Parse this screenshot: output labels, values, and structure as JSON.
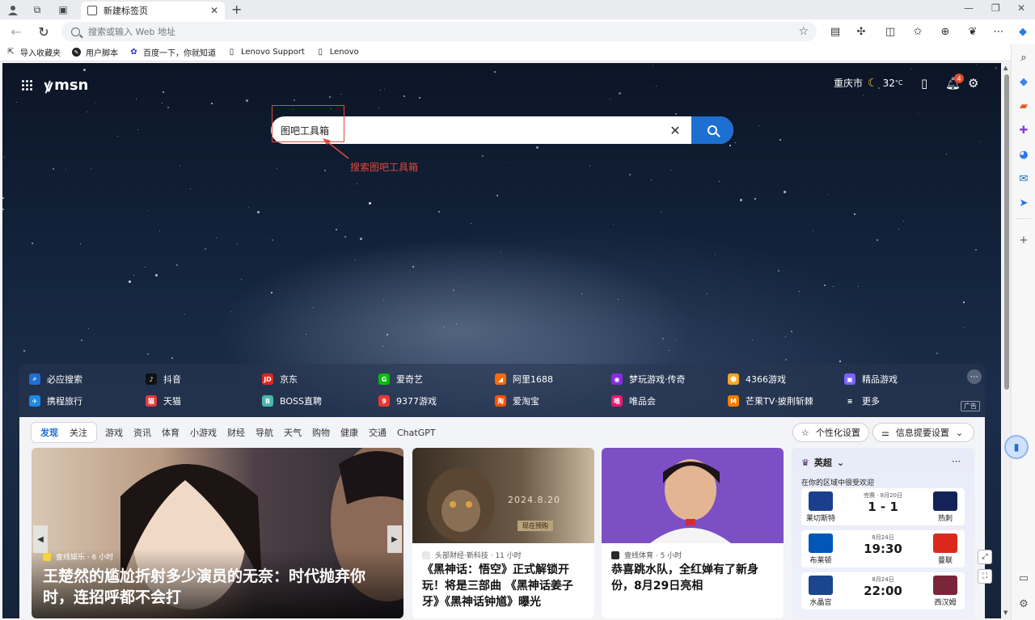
{
  "browser": {
    "tab_title": "新建标签页",
    "address_placeholder": "搜索或输入 Web 地址",
    "bookmarks": [
      "导入收藏夹",
      "用户脚本",
      "百度一下，你就知道",
      "Lenovo Support",
      "Lenovo"
    ]
  },
  "msn": {
    "logo": "msn",
    "city": "重庆市",
    "temperature": "32",
    "temp_unit": "°C",
    "notification_count": "4"
  },
  "search": {
    "query": "图吧工具箱",
    "annotation": "搜索图吧工具箱"
  },
  "quick_links": {
    "row1": [
      "必应搜索",
      "抖音",
      "京东",
      "爱奇艺",
      "阿里1688",
      "梦玩游戏·传奇",
      "4366游戏",
      "精品游戏"
    ],
    "row2": [
      "携程旅行",
      "天猫",
      "BOSS直聘",
      "9377游戏",
      "爱淘宝",
      "唯品会",
      "芒果TV·披荆斩棘",
      "更多"
    ],
    "ad_label": "广告",
    "colors": [
      "#1d6fd1",
      "#111111",
      "#e1251b",
      "#00be06",
      "#ff6a00",
      "#8a2be2",
      "#f5a623",
      "#7b61ff",
      "#1e88e5",
      "#e4393c",
      "#4db6ac",
      "#e53935",
      "#ff5000",
      "#e8196f",
      "#f57c00",
      "#ffffff"
    ]
  },
  "feed": {
    "tabs": [
      "发现",
      "关注"
    ],
    "categories": [
      "游戏",
      "资讯",
      "体育",
      "小游戏",
      "财经",
      "导航",
      "天气",
      "购物",
      "健康",
      "交通",
      "ChatGPT"
    ],
    "personalize": "个性化设置",
    "feed_settings": "信息提要设置"
  },
  "cards": [
    {
      "source": "壹线娱乐 · 6 小时",
      "headline": "王楚然的尴尬折射多少演员的无奈：时代抛弃你时，连招呼都不会打"
    },
    {
      "source": "头部财经·新科技 · 11 小时",
      "headline": "《黑神话：悟空》正式解锁开玩！将是三部曲 《黑神话姜子牙》《黑神话钟馗》曝光",
      "poster_text": "2024.8.20",
      "poster_button": "现在预购"
    },
    {
      "source": "壹线体育 · 5 小时",
      "headline": "恭喜跳水队，全红婵有了新身份，8月29日亮相"
    }
  ],
  "sports": {
    "league": "英超",
    "subtitle": "在你的区域中很受欢迎",
    "matches": [
      {
        "home": "莱切斯特",
        "away": "热刺",
        "meta": "完赛 · 8月20日",
        "score": "1 - 1",
        "home_color": "#1b3f8f",
        "away_color": "#132257"
      },
      {
        "home": "布莱顿",
        "away": "曼联",
        "meta": "8月24日",
        "score": "19:30",
        "home_color": "#0057b8",
        "away_color": "#da291c"
      },
      {
        "home": "水晶宫",
        "away": "西汉姆",
        "meta": "8月24日",
        "score": "22:00",
        "home_color": "#1b458f",
        "away_color": "#7a263a"
      }
    ]
  }
}
